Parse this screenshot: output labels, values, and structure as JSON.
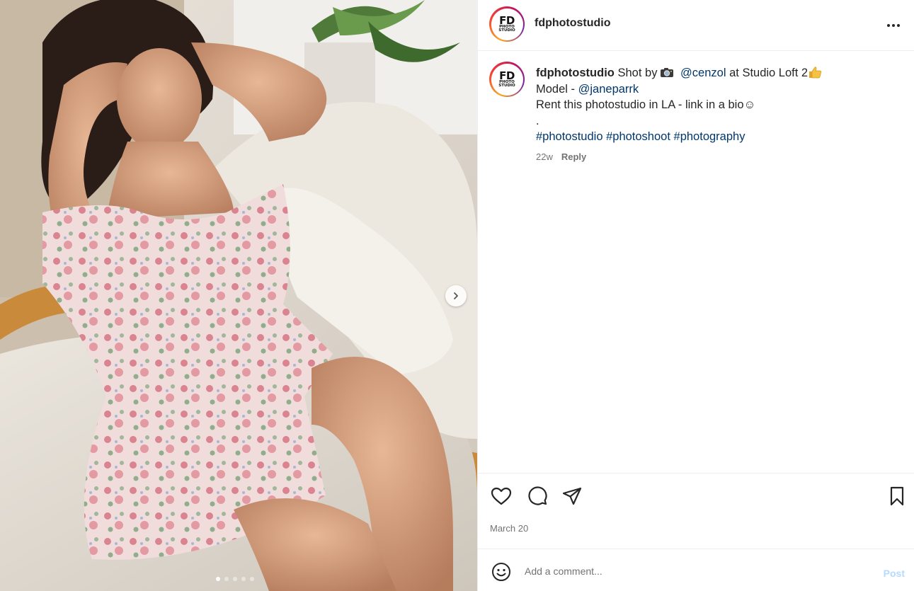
{
  "post": {
    "username": "fdphotostudio",
    "avatar_logo": {
      "big": "FD",
      "line1": "PHOTO",
      "line2": "STUDIO"
    },
    "more_icon": "more-horizontal-icon",
    "caption": {
      "username": "fdphotostudio",
      "shot_by": "Shot by",
      "camera_icon": "camera-emoji",
      "photographer": "@cenzol",
      "location_text": "at Studio Loft 2",
      "thumbs_icon": "thumbs-up-emoji",
      "model_label": "Model -",
      "model": "@janeparrk",
      "rent_text": "Rent this photostudio in LA - link in a bio☺",
      "dot": ".",
      "hashtags": [
        "#photostudio",
        "#photoshoot",
        "#photography"
      ]
    },
    "age": "22w",
    "reply_label": "Reply",
    "date": "March 20",
    "carousel": {
      "slide_count": 5,
      "active_index": 0
    }
  },
  "actions": {
    "like_icon": "heart-icon",
    "comment_icon": "comment-icon",
    "share_icon": "send-icon",
    "save_icon": "bookmark-icon"
  },
  "add_comment": {
    "emoji_icon": "smiley-icon",
    "placeholder": "Add a comment...",
    "post_label": "Post",
    "post_color": "#b3dbff"
  },
  "colors": {
    "link": "#00376b",
    "muted": "#737373",
    "text": "#262626",
    "divider": "#efefef"
  }
}
